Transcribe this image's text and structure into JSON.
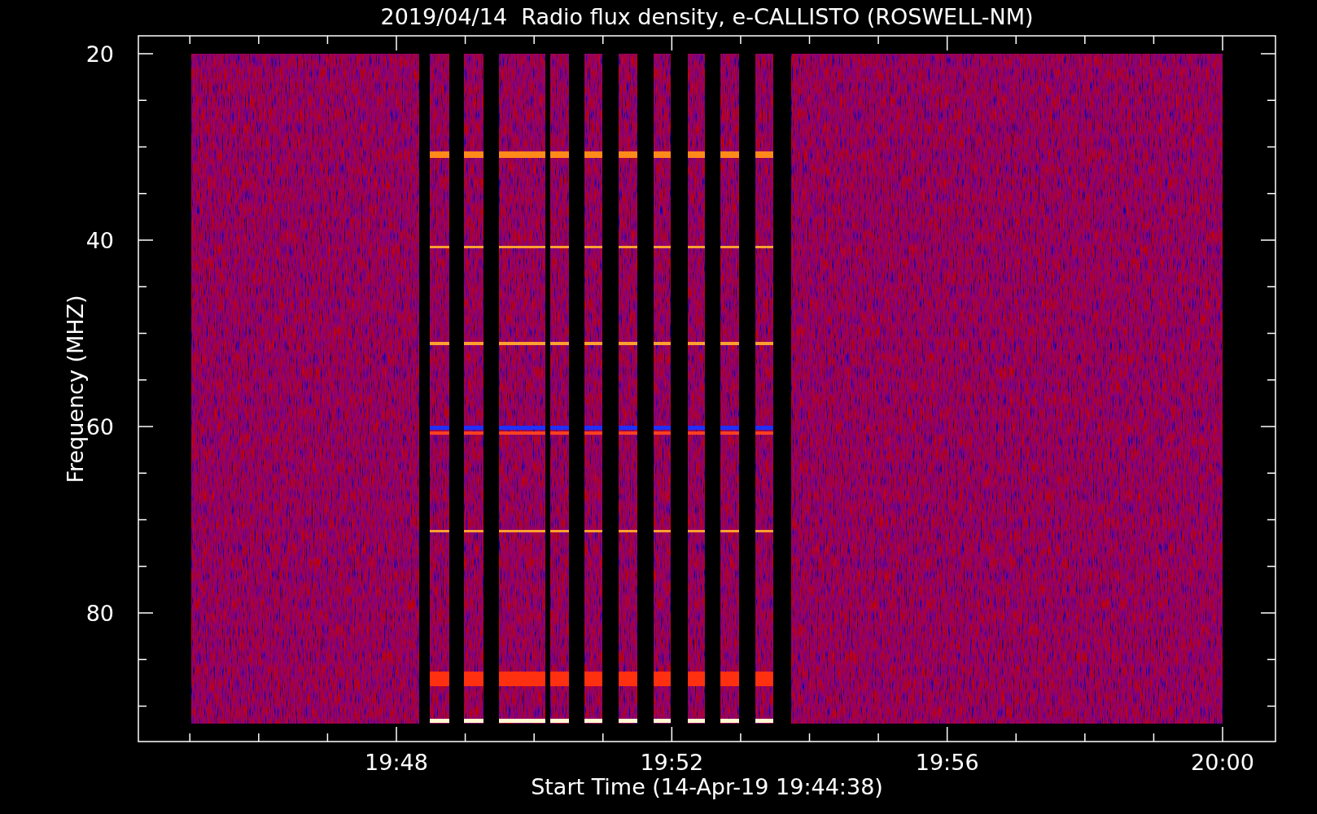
{
  "title": "2019/04/14  Radio flux density, e-CALLISTO (ROSWELL-NM)",
  "y_axis": {
    "label": "Frequency (MHZ)",
    "tick_labels": [
      "20",
      "40",
      "60",
      "80"
    ]
  },
  "x_axis": {
    "label": "Start Time (14-Apr-19 19:44:38)",
    "tick_labels": [
      "19:48",
      "19:52",
      "19:56",
      "20:00"
    ]
  }
}
